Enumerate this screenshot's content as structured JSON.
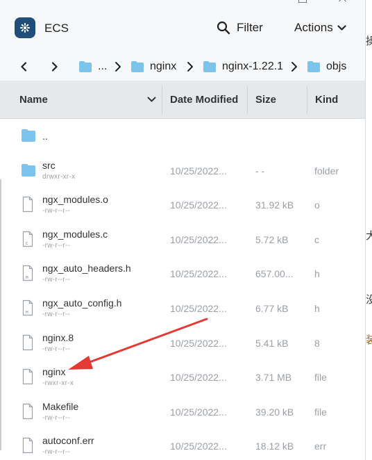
{
  "app": {
    "title": "ECS"
  },
  "toolbar": {
    "filter_label": "Filter",
    "actions_label": "Actions"
  },
  "breadcrumb": {
    "ellipsis": "...",
    "items": [
      "nginx",
      "nginx-1.22.1",
      "objs"
    ]
  },
  "columns": {
    "name": "Name",
    "date": "Date Modified",
    "size": "Size",
    "kind": "Kind"
  },
  "files": [
    {
      "name": "..",
      "perm": "",
      "date": "",
      "size": "",
      "kind": "",
      "type": "folder"
    },
    {
      "name": "src",
      "perm": "drwxr-xr-x",
      "date": "10/25/2022...",
      "size": "- -",
      "kind": "folder",
      "type": "folder"
    },
    {
      "name": "ngx_modules.o",
      "perm": "-rw-r--r--",
      "date": "10/25/2022...",
      "size": "31.92 kB",
      "kind": "o",
      "type": "file"
    },
    {
      "name": "ngx_modules.c",
      "perm": "-rw-r--r--",
      "date": "10/25/2022...",
      "size": "5.72 kB",
      "kind": "c",
      "type": "file",
      "badge": "C"
    },
    {
      "name": "ngx_auto_headers.h",
      "perm": "-rw-r--r--",
      "date": "10/25/2022...",
      "size": "657.00...",
      "kind": "h",
      "type": "file",
      "badge": "H"
    },
    {
      "name": "ngx_auto_config.h",
      "perm": "-rw-r--r--",
      "date": "10/25/2022...",
      "size": "6.77 kB",
      "kind": "h",
      "type": "file",
      "badge": "H"
    },
    {
      "name": "nginx.8",
      "perm": "-rw-r--r--",
      "date": "10/25/2022...",
      "size": "5.41 kB",
      "kind": "8",
      "type": "file"
    },
    {
      "name": "nginx",
      "perm": "-rwxr-xr-x",
      "date": "10/25/2022...",
      "size": "3.71 MB",
      "kind": "file",
      "type": "file"
    },
    {
      "name": "Makefile",
      "perm": "-rw-r--r--",
      "date": "10/25/2022...",
      "size": "39.20 kB",
      "kind": "file",
      "type": "file"
    },
    {
      "name": "autoconf.err",
      "perm": "-rw-r--r--",
      "date": "10/25/2022...",
      "size": "18.12 kB",
      "kind": "err",
      "type": "file"
    }
  ],
  "background_fragments": [
    "操",
    "大",
    "没",
    "装"
  ],
  "colors": {
    "folder": "#7cc4ec",
    "accent_logo": "#1e4e79",
    "annotation_arrow": "#e53935"
  }
}
